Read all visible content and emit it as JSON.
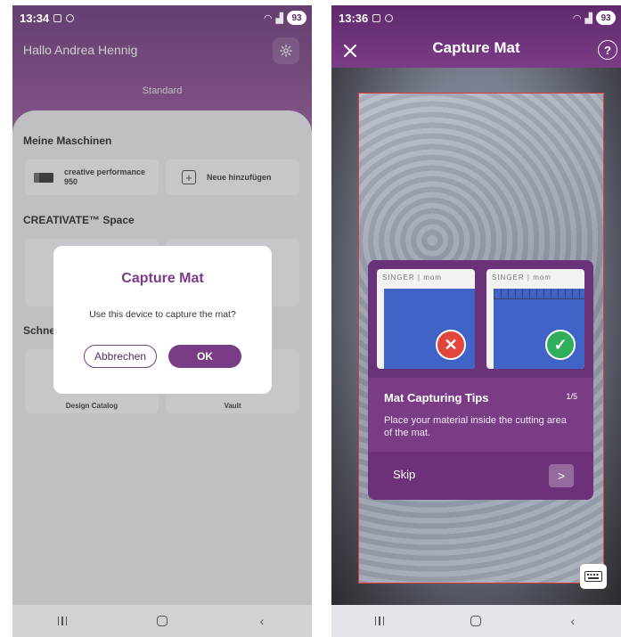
{
  "left_screen": {
    "status": {
      "time": "13:34",
      "battery": "93"
    },
    "greeting": "Hallo Andrea Hennig",
    "settings_icon": "gear-icon",
    "tab_label": "Standard",
    "sections": {
      "machines_title": "Meine Maschinen",
      "creativate_title": "CREATIVATE™ Space",
      "schnell_partial": "Schne"
    },
    "machine_card": {
      "name_line1": "creative performance",
      "name_line2": "950"
    },
    "add_card": {
      "label": "Neue hinzufügen"
    },
    "bottom_cards": {
      "left": "Design Catalog",
      "right": "Vault"
    },
    "dialog": {
      "title": "Capture Mat",
      "message": "Use this device to capture the mat?",
      "cancel_label": "Abbrechen",
      "ok_label": "OK"
    }
  },
  "right_screen": {
    "status": {
      "time": "13:36",
      "battery": "93"
    },
    "title": "Capture Mat",
    "help_label": "?",
    "tips": {
      "brand_text": "SINGER | mom",
      "title": "Mat Capturing Tips",
      "page": "1/5",
      "body": "Place your material inside the cutting area of the mat.",
      "skip_label": "Skip",
      "next_label": ">"
    }
  },
  "colors": {
    "brand_purple": "#7b3c86",
    "frame_red": "#e43a3a",
    "bad_red": "#e2463a",
    "good_green": "#2fae5b"
  }
}
